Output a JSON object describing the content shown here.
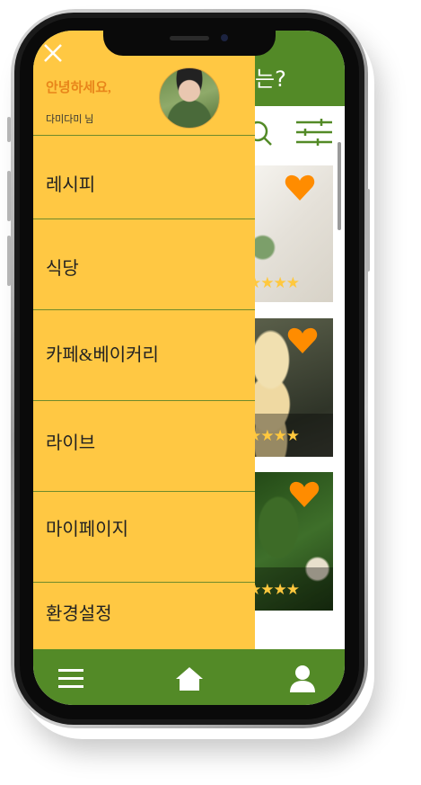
{
  "header": {
    "title_fragment": "는?"
  },
  "drawer": {
    "greeting": "안녕하세요,",
    "username": "다미다미 님",
    "menu": [
      {
        "label": "레시피"
      },
      {
        "label": "식당"
      },
      {
        "label": "카페&베이커리"
      },
      {
        "label": "라이브"
      },
      {
        "label": "마이페이지"
      },
      {
        "label": "환경설정"
      }
    ]
  },
  "cards": [
    {
      "stars": "★★★★",
      "favorited": true
    },
    {
      "stars": "★★★★",
      "favorited": true
    },
    {
      "stars": "★★★★",
      "favorited": true
    }
  ],
  "colors": {
    "brand_green": "#538a27",
    "drawer_yellow": "#ffc843",
    "accent_orange": "#ff8c00",
    "star_yellow": "#ffc83e"
  },
  "icons": [
    "close-icon",
    "search-icon",
    "filter-icon",
    "heart-icon",
    "menu-icon",
    "home-icon",
    "profile-icon"
  ]
}
